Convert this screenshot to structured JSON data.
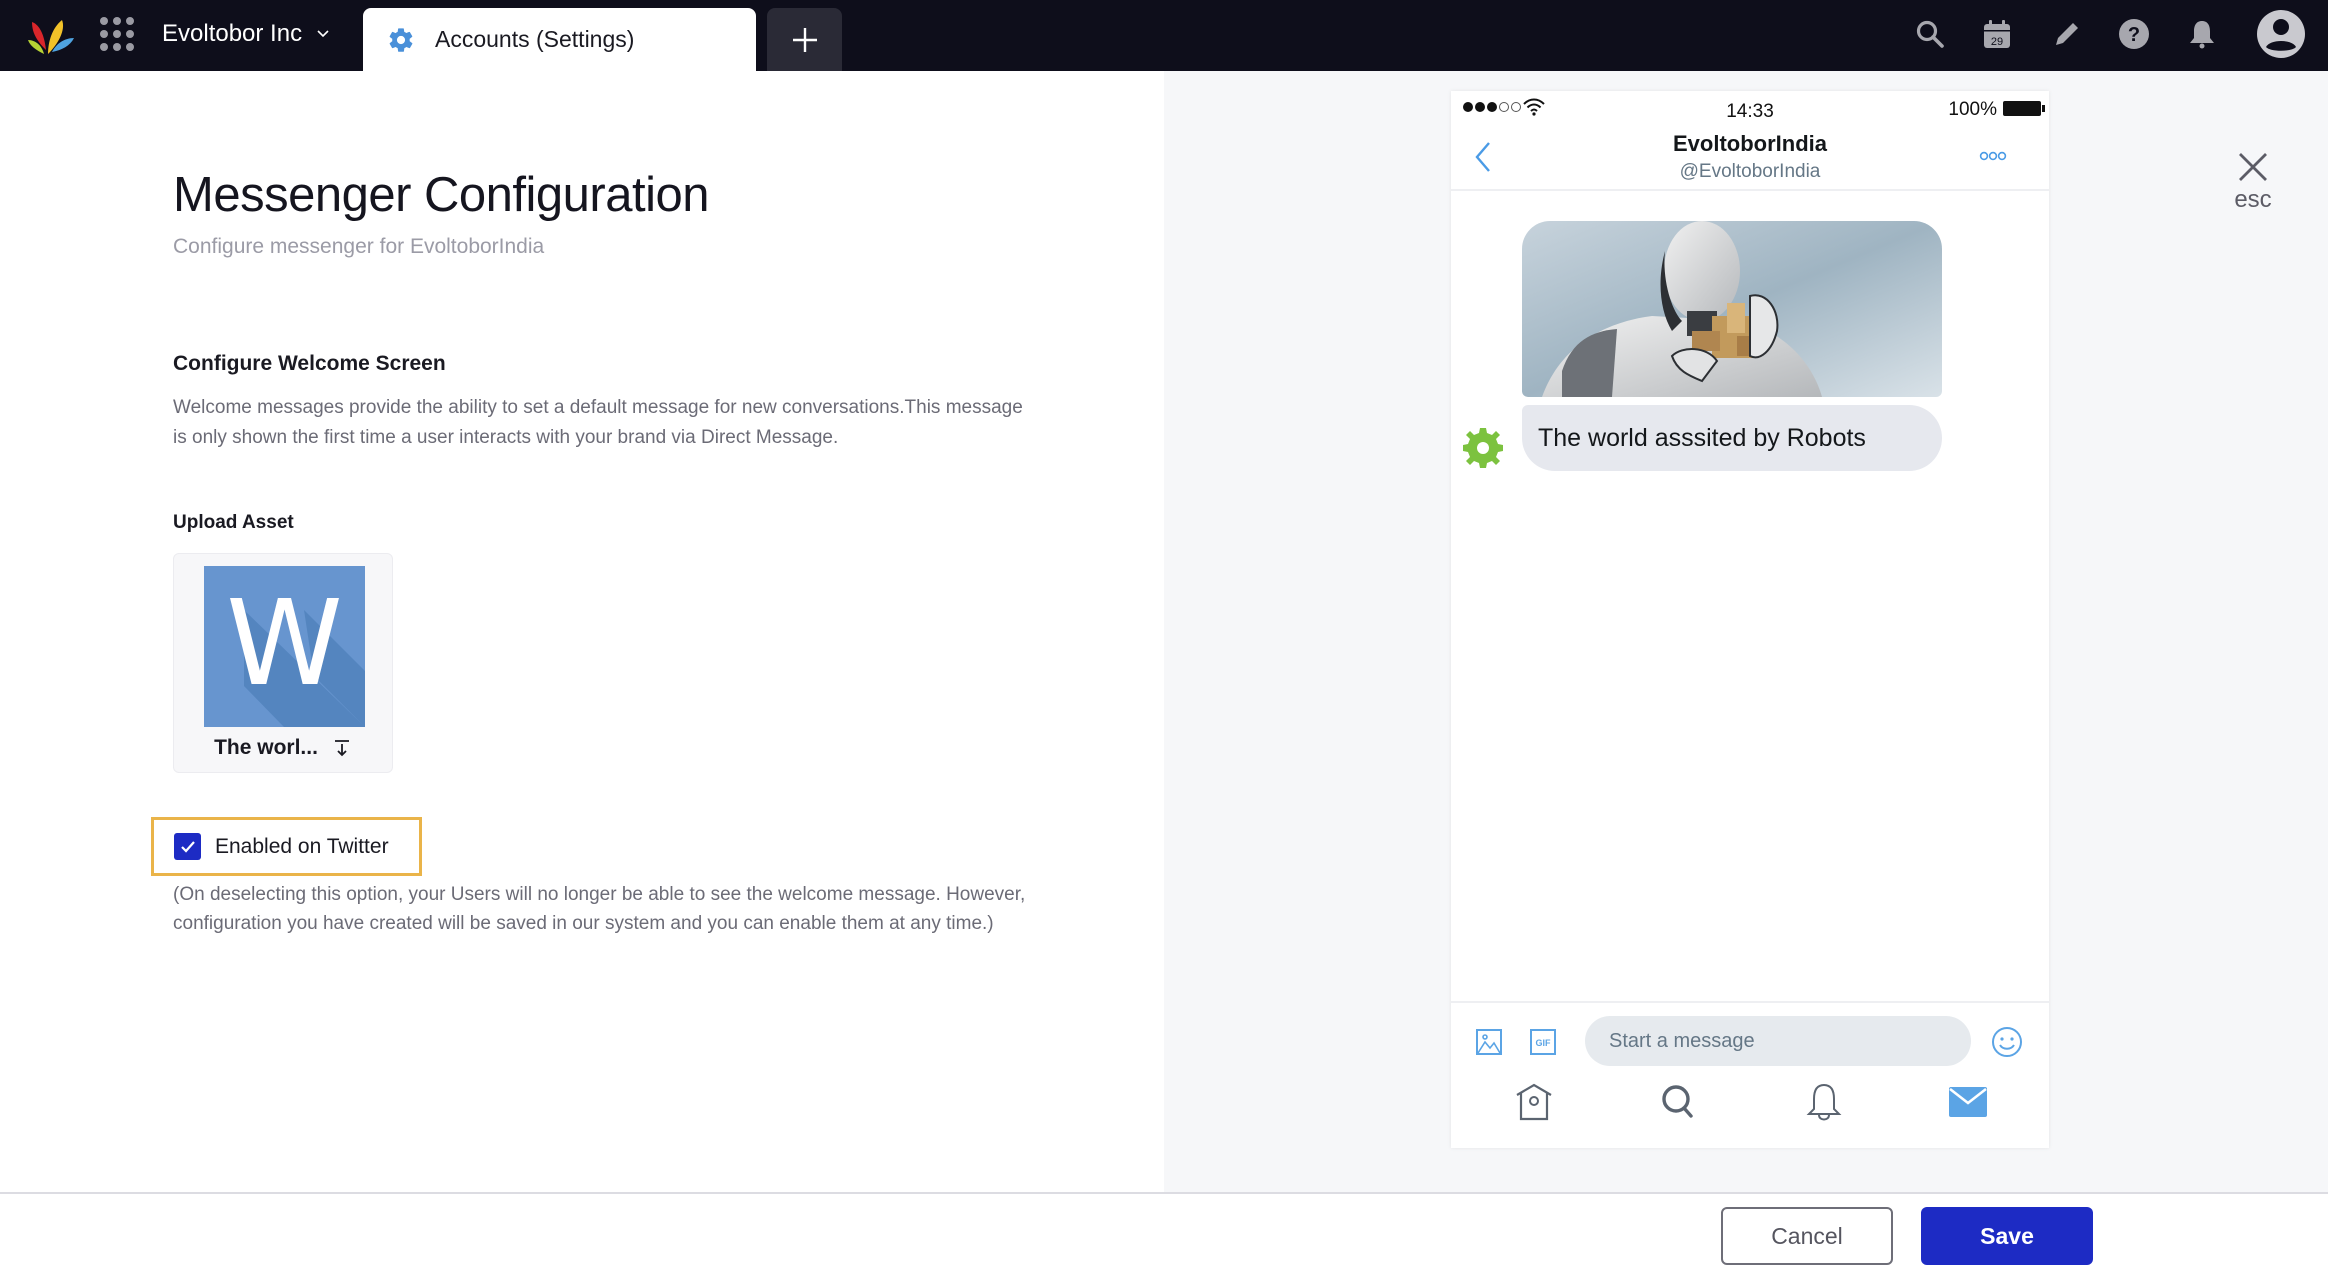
{
  "topbar": {
    "org_name": "Evoltobor Inc",
    "active_tab": "Accounts (Settings)",
    "icons": [
      "search-icon",
      "calendar-icon",
      "pencil-icon",
      "help-icon",
      "bell-icon",
      "user-avatar-icon"
    ],
    "calendar_day": "29"
  },
  "page": {
    "title": "Messenger Configuration",
    "subtitle": "Configure messenger for EvoltoborIndia"
  },
  "welcome": {
    "title": "Configure Welcome Screen",
    "description": "Welcome messages provide the ability to set a default message for new conversations.This message is only shown the first time a user interacts with your brand via Direct Message."
  },
  "upload": {
    "label": "Upload Asset",
    "asset_letter": "W",
    "asset_name": "The worl..."
  },
  "twitter_toggle": {
    "label": "Enabled on Twitter",
    "checked": true,
    "note": "(On deselecting this option, your Users will no longer be able to see the welcome message. However, configuration you have created will be saved in our system and you can enable them at any time.)"
  },
  "preview": {
    "status_time": "14:33",
    "battery": "100%",
    "signal_bars_filled": 3,
    "signal_bars_total": 5,
    "account_name": "EvoltoborIndia",
    "account_handle": "@EvoltoborIndia",
    "message_text": "The world asssited by Robots",
    "compose_placeholder": "Start a message",
    "nav_icons": [
      "home-icon",
      "search-icon",
      "notifications-icon",
      "messages-icon"
    ],
    "active_nav": "messages"
  },
  "close": {
    "label": "esc"
  },
  "footer": {
    "cancel_label": "Cancel",
    "save_label": "Save"
  },
  "colors": {
    "topbar_bg": "#0e0e1b",
    "primary": "#1d2bc4",
    "highlight_border": "#eab449",
    "twitter_blue": "#5ba4e5",
    "asset_tile": "#6795cf"
  }
}
